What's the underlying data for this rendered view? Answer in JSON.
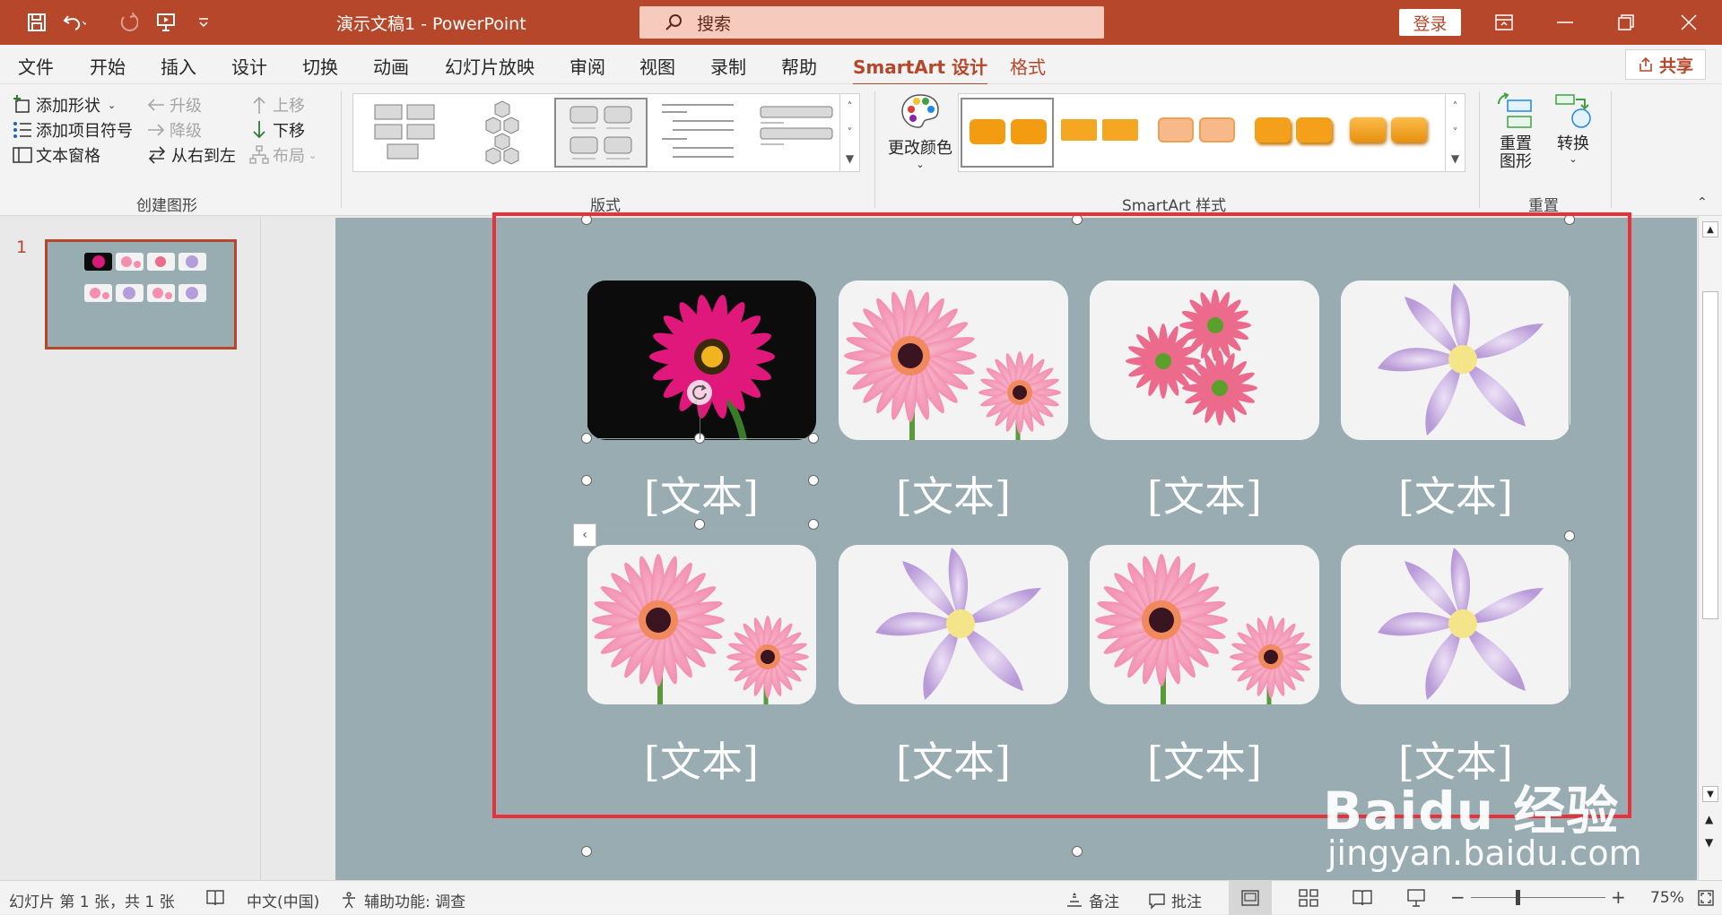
{
  "titlebar": {
    "doc_title": "演示文稿1  -  PowerPoint",
    "search_placeholder": "搜索",
    "login_label": "登录"
  },
  "menu": {
    "items": [
      "文件",
      "开始",
      "插入",
      "设计",
      "切换",
      "动画",
      "幻灯片放映",
      "审阅",
      "视图",
      "录制",
      "帮助",
      "SmartArt 设计",
      "格式"
    ],
    "active": "SmartArt 设计",
    "share_label": "共享"
  },
  "ribbon": {
    "create_graphic": {
      "add_shape": "添加形状",
      "add_bullet": "添加项目符号",
      "text_pane": "文本窗格",
      "promote": "升级",
      "demote": "降级",
      "right_to_left": "从右到左",
      "move_up": "上移",
      "move_down": "下移",
      "layout": "布局",
      "label": "创建图形"
    },
    "layouts_label": "版式",
    "change_colors": "更改颜色",
    "smartart_styles_label": "SmartArt 样式",
    "reset_graphic": "重置\n图形",
    "reset_graphic_l1": "重置",
    "reset_graphic_l2": "图形",
    "convert": "转换",
    "reset_label": "重置",
    "style_colors": [
      "#f39c12",
      "#f5a623",
      "#f8b98a",
      "#f5a01a",
      "#f3a323"
    ]
  },
  "slides_pane": {
    "slide_number": "1"
  },
  "slide": {
    "captions": [
      "[文本]",
      "[文本]",
      "[文本]",
      "[文本]",
      "[文本]",
      "[文本]",
      "[文本]",
      "[文本]"
    ]
  },
  "statusbar": {
    "slide_info": "幻灯片 第 1 张，共 1 张",
    "language": "中文(中国)",
    "accessibility": "辅助功能: 调查",
    "notes": "备注",
    "comments": "批注",
    "zoom": "75%"
  },
  "watermark": {
    "line1": "Baidu 经验",
    "line2": "jingyan.baidu.com"
  }
}
